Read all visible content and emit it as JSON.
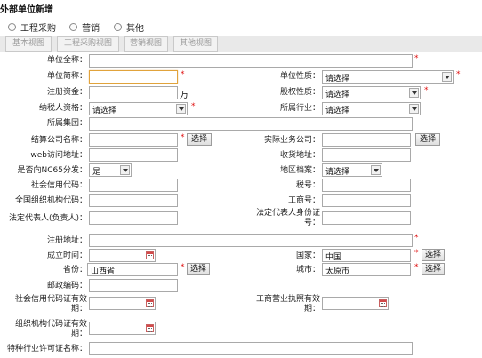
{
  "window": {
    "title": "外部单位新增"
  },
  "radios": [
    "工程采购",
    "营销",
    "其他"
  ],
  "tabs": [
    "基本视图",
    "工程采购视图",
    "营销视图",
    "其他视图"
  ],
  "labels": {
    "full_name": "单位全称：",
    "short_name": "单位简称：",
    "unit_nature": "单位性质：",
    "reg_capital": "注册资金：",
    "equity_nature": "股权性质：",
    "taxpayer": "纳税人资格：",
    "industry": "所属行业：",
    "group": "所属集团：",
    "settle_company": "结算公司名称：",
    "actual_company": "实际业务公司：",
    "web": "web访问地址：",
    "receipt_addr": "收货地址：",
    "nc65": "是否向NC65分发：",
    "region": "地区档案：",
    "credit_code": "社会信用代码：",
    "tax_no": "税号：",
    "org_code": "全国组织机构代码：",
    "biz_no": "工商号：",
    "legal_rep": "法定代表人(负责人)：",
    "legal_id": "法定代表人身份证号：",
    "reg_addr": "注册地址：",
    "found_time": "成立时间：",
    "country": "国家：",
    "province": "省份：",
    "city": "城市：",
    "zip": "邮政编码：",
    "credit_valid": "社会信用代码证有效期：",
    "license_valid": "工商营业执照有效期：",
    "org_valid": "组织机构代码证有效期：",
    "special_permit": "特种行业许可证名称："
  },
  "values": {
    "unit_nature": "请选择",
    "equity_nature": "请选择",
    "taxpayer": "请选择",
    "industry": "请选择",
    "nc65": "是",
    "region": "请选择",
    "country": "中国",
    "province": "山西省",
    "city": "太原市"
  },
  "unit_wan": "万",
  "select_label": "选择",
  "required_mark": "*"
}
